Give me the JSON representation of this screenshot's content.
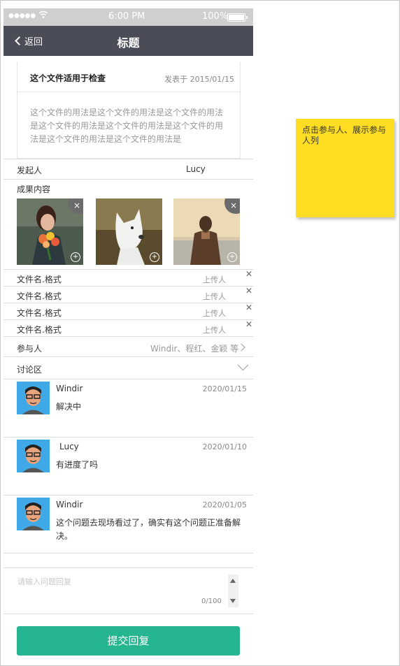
{
  "status_bar": {
    "signal": "●●●●●",
    "time": "6:00 PM",
    "battery": "100%"
  },
  "nav": {
    "back_label": "返回",
    "title": "标题"
  },
  "doc": {
    "title": "这个文件适用于检查",
    "date": "发表于 2015/01/15",
    "body": "这个文件的用法是这个文件的用法是这个文件的用法是这个文件的用法是这个文件的用法是这个文件的用法是这个文件的用法是这个文件的用法是"
  },
  "initiator": {
    "label": "发起人",
    "value": "Lucy"
  },
  "results": {
    "label": "成果内容",
    "delete_icon": "×"
  },
  "files": [
    {
      "name": "文件名.格式",
      "uploader": "上传人"
    },
    {
      "name": "文件名.格式",
      "uploader": "上传人"
    },
    {
      "name": "文件名.格式",
      "uploader": "上传人"
    },
    {
      "name": "文件名.格式",
      "uploader": "上传人"
    }
  ],
  "participants": {
    "label": "参与人",
    "value": "Windir、程红、金颖 等"
  },
  "discussion": {
    "label": "讨论区"
  },
  "comments": [
    {
      "name": "Windir",
      "date": "2020/01/15",
      "text": "解决中"
    },
    {
      "name": "Lucy",
      "date": "2020/01/10",
      "text": "有进度了吗"
    },
    {
      "name": "Windir",
      "date": "2020/01/05",
      "text": "这个问题去现场看过了，确实有这个问题正准备解决。"
    }
  ],
  "reply": {
    "placeholder": "请输入问题回复",
    "counter": "0/100"
  },
  "submit_label": "提交回复",
  "annotation": {
    "text": "点击参与人、展示参与人列"
  },
  "colors": {
    "nav_bg": "#4a4d58",
    "submit_bg": "#26b591",
    "note_bg": "#ffdd22",
    "avatar_bg": "#3fa8e6"
  }
}
